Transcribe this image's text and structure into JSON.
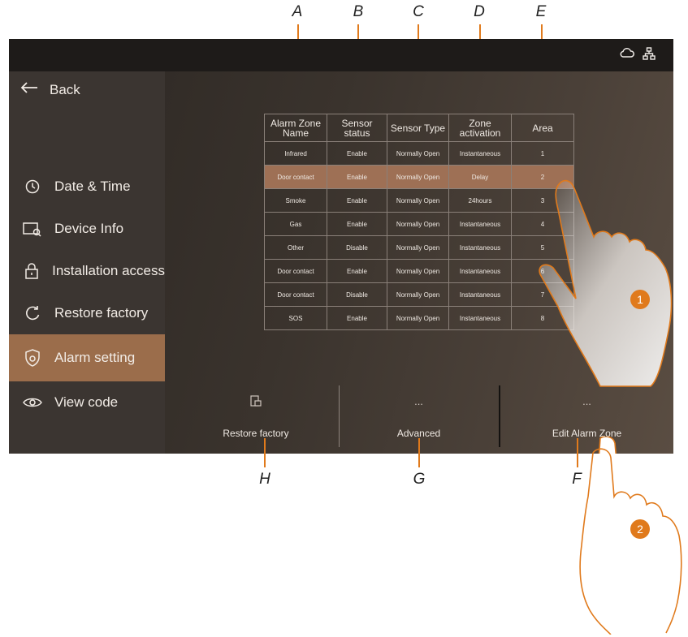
{
  "callouts": {
    "top": [
      "A",
      "B",
      "C",
      "D",
      "E"
    ],
    "bottom": [
      "H",
      "G",
      "F"
    ],
    "steps": [
      "1",
      "2"
    ]
  },
  "topbar": {
    "icons": [
      "cloud-icon",
      "network-icon"
    ]
  },
  "sidebar": {
    "back_label": "Back",
    "items": [
      {
        "label": "Date & Time",
        "icon": "clock-icon"
      },
      {
        "label": "Device Info",
        "icon": "device-info-icon"
      },
      {
        "label": "Installation access",
        "icon": "lock-icon"
      },
      {
        "label": "Restore factory",
        "icon": "restore-icon"
      },
      {
        "label": "Alarm setting",
        "icon": "alarm-shield-icon",
        "active": true
      },
      {
        "label": "View code",
        "icon": "eye-icon"
      }
    ]
  },
  "table": {
    "headers": [
      "Alarm Zone Name",
      "Sensor status",
      "Sensor Type",
      "Zone activation",
      "Area"
    ],
    "rows": [
      [
        "Infrared",
        "Enable",
        "Normally Open",
        "Instantaneous",
        "1"
      ],
      [
        "Door contact",
        "Enable",
        "Normally Open",
        "Delay",
        "2"
      ],
      [
        "Smoke",
        "Enable",
        "Normally Open",
        "24hours",
        "3"
      ],
      [
        "Gas",
        "Enable",
        "Normally Open",
        "Instantaneous",
        "4"
      ],
      [
        "Other",
        "Disable",
        "Normally Open",
        "Instantaneous",
        "5"
      ],
      [
        "Door contact",
        "Enable",
        "Normally Open",
        "Instantaneous",
        "6"
      ],
      [
        "Door contact",
        "Disable",
        "Normally Open",
        "Instantaneous",
        "7"
      ],
      [
        "SOS",
        "Enable",
        "Normally Open",
        "Instantaneous",
        "8"
      ]
    ],
    "selected_row": 1
  },
  "bottom": {
    "restore_label": "Restore factory",
    "advanced_label": "Advanced",
    "advanced_dots": "...",
    "edit_label": "Edit Alarm Zone",
    "edit_dots": "..."
  },
  "colors": {
    "accent": "#e07a1c",
    "selected": "#9b6d4b"
  }
}
